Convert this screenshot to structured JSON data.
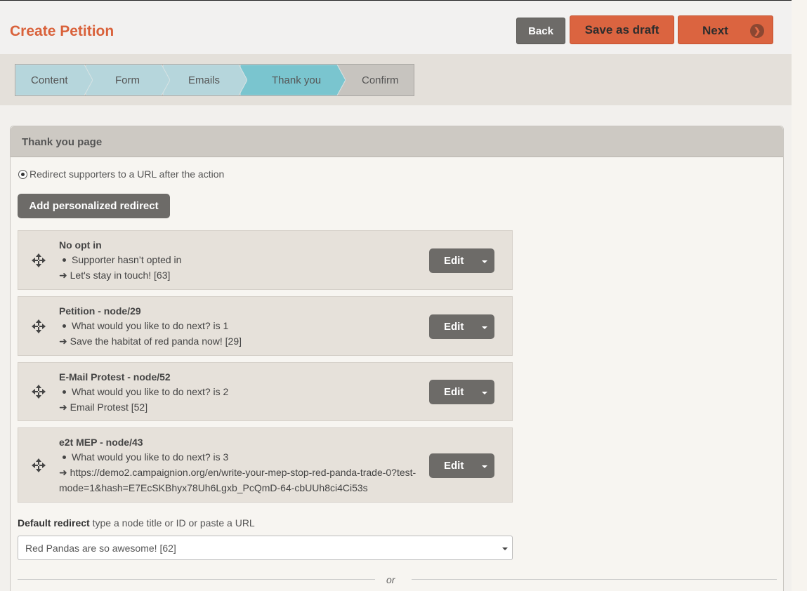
{
  "header": {
    "title": "Create Petition",
    "back_label": "Back",
    "draft_label": "Save as draft",
    "next_label": "Next",
    "next_icon": "chevron-right-circle-icon"
  },
  "steps": [
    {
      "label": "Content",
      "state": "done"
    },
    {
      "label": "Form",
      "state": "done"
    },
    {
      "label": "Emails",
      "state": "done"
    },
    {
      "label": "Thank you",
      "state": "active"
    },
    {
      "label": "Confirm",
      "state": "pending"
    }
  ],
  "colors": {
    "accent": "#db6440",
    "step_done": "#b6d6dc",
    "step_active": "#7ac5cf",
    "step_pending": "#c7c4bf",
    "button_gray": "#6d6b68"
  },
  "panel": {
    "title": "Thank you page",
    "radio_label": "Redirect supporters to a URL after the action",
    "add_button": "Add personalized redirect",
    "rules": [
      {
        "title": "No opt in",
        "condition": "Supporter hasn’t opted in",
        "target_lines": [
          "➜ Let's stay in touch! [63]"
        ],
        "edit_label": "Edit"
      },
      {
        "title": "Petition - node/29",
        "condition": "What would you like to do next? is 1",
        "target_lines": [
          "➜ Save the habitat of red panda now! [29]"
        ],
        "edit_label": "Edit"
      },
      {
        "title": "E-Mail Protest - node/52",
        "condition": "What would you like to do next? is 2",
        "target_lines": [
          "➜ Email Protest [52]"
        ],
        "edit_label": "Edit"
      },
      {
        "title": "e2t MEP - node/43",
        "condition": "What would you like to do next? is 3",
        "target_lines": [
          "➜ https://demo2.campaignion.org/en/write-your-mep-stop-red-panda-trade-0?test-",
          "mode=1&hash=E7EcSKBhyx78Uh6Lgxb_PcQmD-64-cbUUh8ci4Ci53s"
        ],
        "edit_label": "Edit"
      }
    ],
    "default_label": "Default redirect",
    "default_hint": "type a node title or ID or paste a URL",
    "default_value": "Red Pandas are so awesome! [62]",
    "or_text": "or"
  }
}
